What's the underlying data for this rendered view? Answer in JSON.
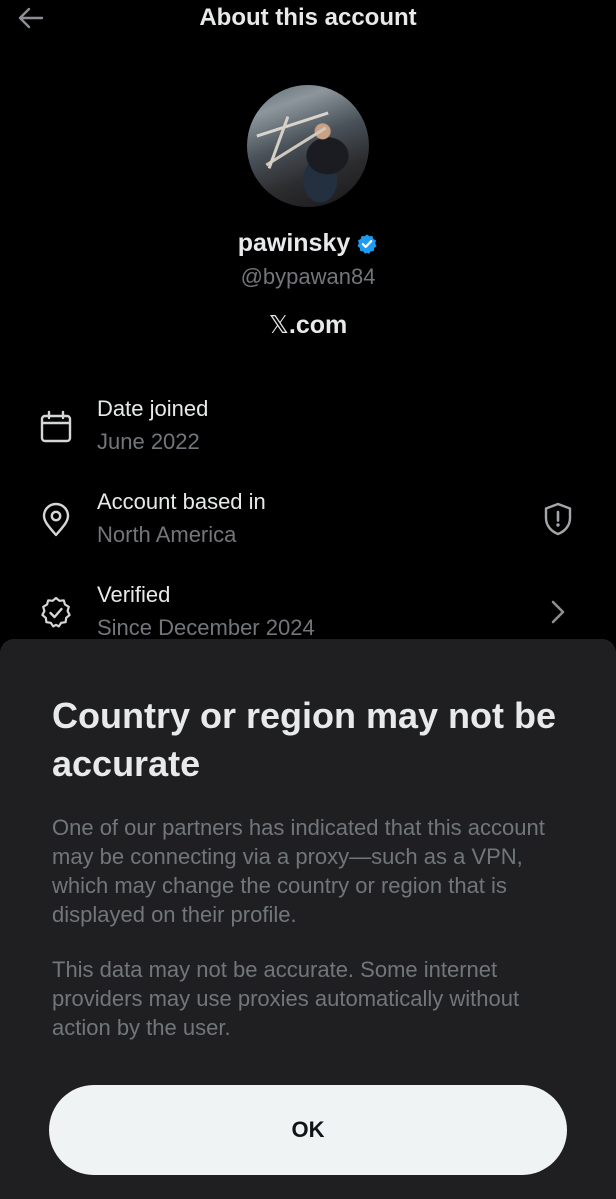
{
  "header": {
    "title": "About this account",
    "back_icon": "arrow-left-icon"
  },
  "profile": {
    "display_name": "pawinsky",
    "verified_badge_color": "#1d9bf0",
    "handle": "@bypawan84",
    "site_mark": "𝕏",
    "site_suffix": ".com"
  },
  "details": [
    {
      "icon": "calendar-icon",
      "label": "Date joined",
      "value": "June 2022"
    },
    {
      "icon": "location-pin-icon",
      "label": "Account based in",
      "value": "North America",
      "trailing_icon": "shield-alert-icon"
    },
    {
      "icon": "verified-check-icon",
      "label": "Verified",
      "value": "Since December 2024",
      "trailing_icon": "chevron-right-icon"
    }
  ],
  "sheet": {
    "title": "Country or region may not be accurate",
    "paragraph_1": "One of our partners has indicated that this account may be connecting via a proxy—such as a VPN, which may change the country or region that is displayed on their profile.",
    "paragraph_2": "This data may not be accurate. Some internet providers may use proxies automatically without action by the user.",
    "ok_label": "OK"
  },
  "colors": {
    "background": "#000000",
    "sheet_background": "#1f1f21",
    "primary_text": "#e7e9ea",
    "secondary_text": "#71767b",
    "button_background": "#eff3f4"
  }
}
